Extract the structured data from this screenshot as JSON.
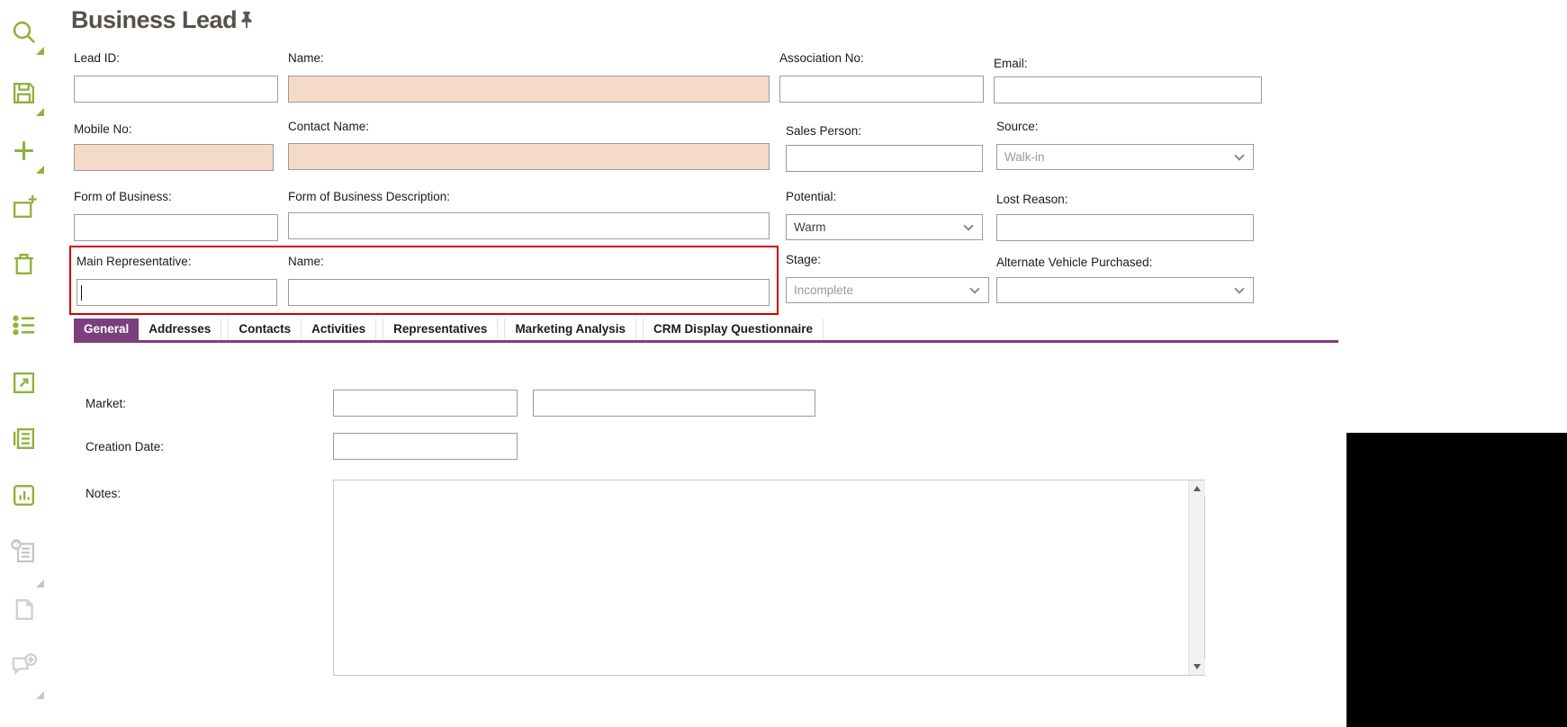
{
  "title": "Business Lead",
  "colors": {
    "accent_purple": "#7B3F7F",
    "icon_green": "#8FB13C",
    "required_field_bg": "#F5DBC7",
    "highlight_border": "#D40000"
  },
  "sidebar": {
    "icons": [
      {
        "name": "search",
        "enabled": true
      },
      {
        "name": "save",
        "enabled": true
      },
      {
        "name": "add",
        "enabled": true
      },
      {
        "name": "add-record",
        "enabled": true
      },
      {
        "name": "delete",
        "enabled": true
      },
      {
        "name": "list",
        "enabled": true
      },
      {
        "name": "export",
        "enabled": true
      },
      {
        "name": "details-list",
        "enabled": true
      },
      {
        "name": "chart",
        "enabled": true
      },
      {
        "name": "questionnaire",
        "enabled": false
      },
      {
        "name": "note",
        "enabled": false
      },
      {
        "name": "add-comment",
        "enabled": false
      }
    ]
  },
  "form": {
    "lead_id": {
      "label": "Lead ID:",
      "value": ""
    },
    "name": {
      "label": "Name:",
      "value": ""
    },
    "association_no": {
      "label": "Association No:",
      "value": ""
    },
    "email": {
      "label": "Email:",
      "value": ""
    },
    "mobile_no": {
      "label": "Mobile No:",
      "value": ""
    },
    "contact_name": {
      "label": "Contact Name:",
      "value": ""
    },
    "sales_person": {
      "label": "Sales Person:",
      "value": ""
    },
    "source": {
      "label": "Source:",
      "value": "Walk-in"
    },
    "form_of_business": {
      "label": "Form of Business:",
      "value": ""
    },
    "form_of_business_description": {
      "label": "Form of Business Description:",
      "value": ""
    },
    "potential": {
      "label": "Potential:",
      "value": "Warm"
    },
    "lost_reason": {
      "label": "Lost Reason:",
      "value": ""
    },
    "main_representative": {
      "label": "Main Representative:",
      "value": ""
    },
    "main_representative_name": {
      "label": "Name:",
      "value": ""
    },
    "stage": {
      "label": "Stage:",
      "value": "Incomplete"
    },
    "alternate_vehicle_purchased": {
      "label": "Alternate Vehicle Purchased:",
      "value": ""
    }
  },
  "tabs": {
    "active": "General",
    "items": [
      {
        "label": "General"
      },
      {
        "label": "Addresses"
      },
      {
        "label": "Contacts"
      },
      {
        "label": "Activities"
      },
      {
        "label": "Representatives"
      },
      {
        "label": "Marketing Analysis"
      },
      {
        "label": "CRM Display Questionnaire"
      }
    ]
  },
  "general_tab": {
    "market_label": "Market:",
    "creation_date_label": "Creation Date:",
    "notes_label": "Notes:",
    "market_code": "",
    "market_description": "",
    "creation_date": "",
    "notes": ""
  }
}
